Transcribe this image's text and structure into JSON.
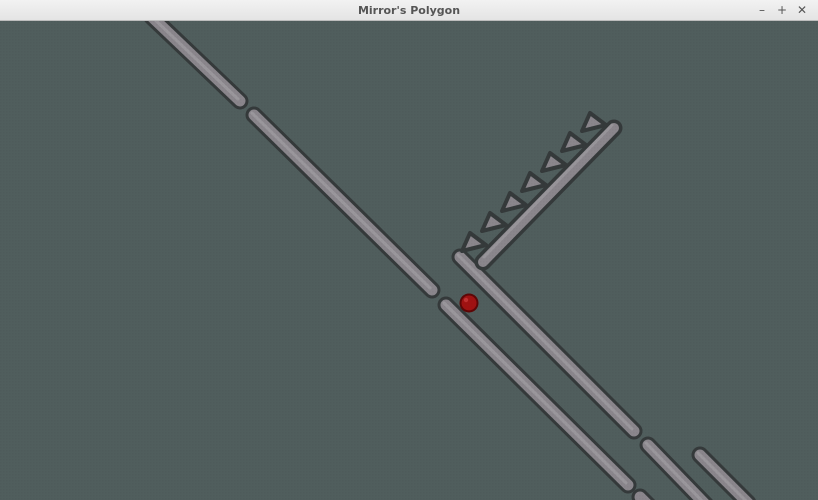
{
  "window": {
    "title": "Mirror's Polygon",
    "minimize_glyph": "–",
    "maximize_glyph": "+",
    "close_glyph": "✕"
  },
  "game": {
    "background_color": "#505e5d",
    "platform_fill": "#8a868c",
    "platform_highlight": "#a29fa4",
    "platform_edge": "#353a3b",
    "ball_color": "#a01212"
  },
  "icons": {
    "minimize": "minimize-icon",
    "maximize": "maximize-icon",
    "close": "close-icon"
  }
}
